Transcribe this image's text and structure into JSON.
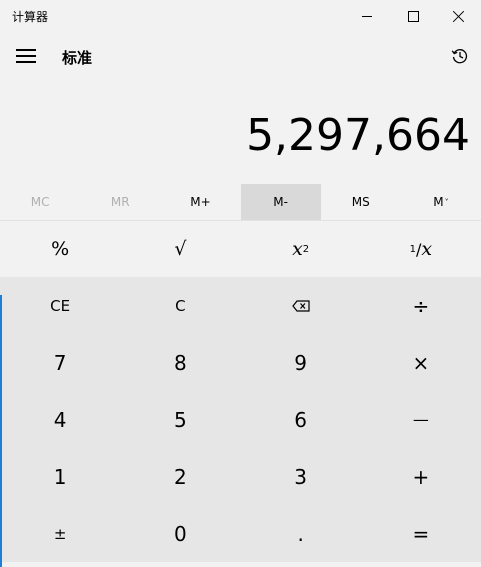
{
  "window": {
    "title": "计算器"
  },
  "header": {
    "mode": "标准"
  },
  "display": {
    "value": "5,297,664"
  },
  "memory": [
    {
      "label": "MC",
      "enabled": false
    },
    {
      "label": "MR",
      "enabled": false
    },
    {
      "label": "M+",
      "enabled": true
    },
    {
      "label": "M-",
      "enabled": true,
      "pressed": true
    },
    {
      "label": "MS",
      "enabled": true
    },
    {
      "label": "M",
      "enabled": true,
      "suffix": "˅"
    }
  ],
  "keys": {
    "percent": "%",
    "sqrt": "√",
    "square_base": "x",
    "square_exp": "2",
    "reciprocal_num": "1",
    "reciprocal_den": "x",
    "ce": "CE",
    "c": "C",
    "divide": "÷",
    "seven": "7",
    "eight": "8",
    "nine": "9",
    "multiply": "×",
    "four": "4",
    "five": "5",
    "six": "6",
    "minus": "—",
    "one": "1",
    "two": "2",
    "three": "3",
    "plus": "+",
    "negate": "±",
    "zero": "0",
    "decimal": ".",
    "equals": "="
  },
  "icons": {
    "menu": "hamburger-icon",
    "history": "history-icon",
    "backspace": "backspace-icon"
  }
}
